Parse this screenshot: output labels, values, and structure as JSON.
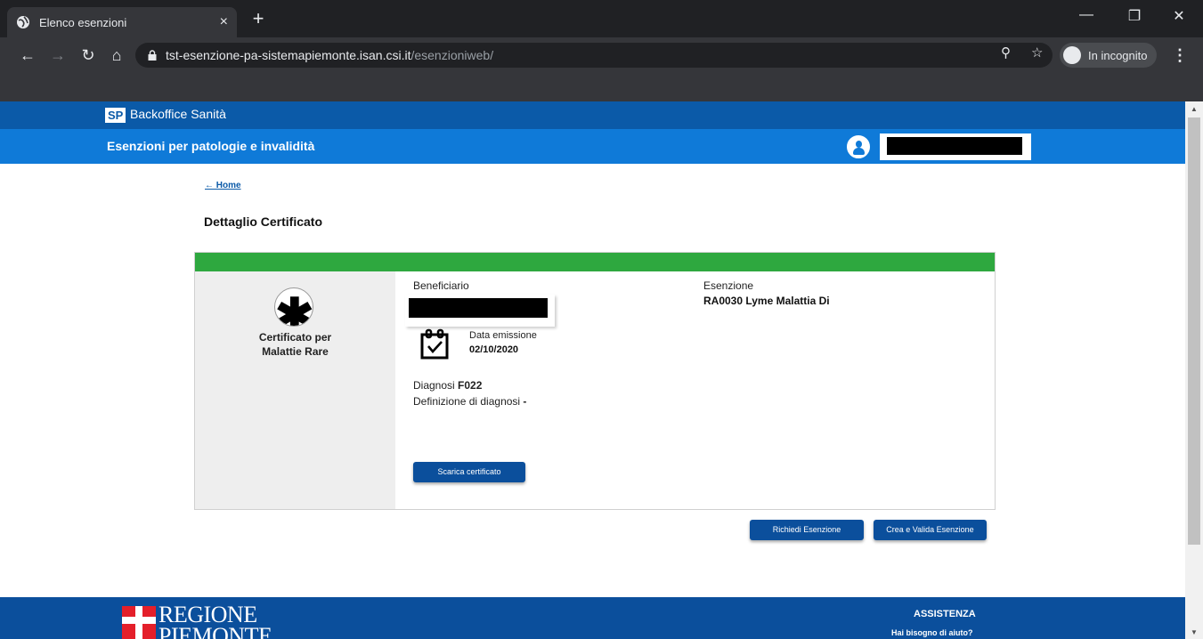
{
  "browser": {
    "tab_title": "Elenco esenzioni",
    "new_tab": "+",
    "close_tab": "×",
    "url_host": "tst-esenzione-pa-sistemapiemonte.isan.csi.it",
    "url_path": "/esenzioniweb/",
    "incognito_label": "In incognito"
  },
  "header": {
    "sp_logo": "SP",
    "brand": "Backoffice Sanità",
    "app_title": "Esenzioni per patologie e invalidità"
  },
  "breadcrumb": {
    "home": "← Home"
  },
  "page": {
    "title": "Dettaglio Certificato"
  },
  "certificate": {
    "type_line1": "Certificato per",
    "type_line2": "Malattie Rare",
    "beneficiary_label": "Beneficiario",
    "issue_date_label": "Data emissione",
    "issue_date": "02/10/2020",
    "diagnosis_label": "Diagnosi",
    "diagnosis_code": "F022",
    "definition_label": "Definizione di diagnosi",
    "definition_value": "-",
    "exemption_label": "Esenzione",
    "exemption_value": "RA0030 Lyme Malattia Di",
    "download_button": "Scarica certificato"
  },
  "actions": {
    "request_button": "Richiedi Esenzione",
    "create_validate_button": "Crea e Valida Esenzione"
  },
  "footer": {
    "region_line1": "REGIONE",
    "region_line2": "PIEMONTE",
    "assistance": "ASSISTENZA",
    "help": "Hai bisogno di aiuto?"
  },
  "colors": {
    "header_dark": "#0b5aa8",
    "header_light": "#0f7ad8",
    "status_green": "#2ea83f",
    "button_blue": "#0b4f9c"
  }
}
